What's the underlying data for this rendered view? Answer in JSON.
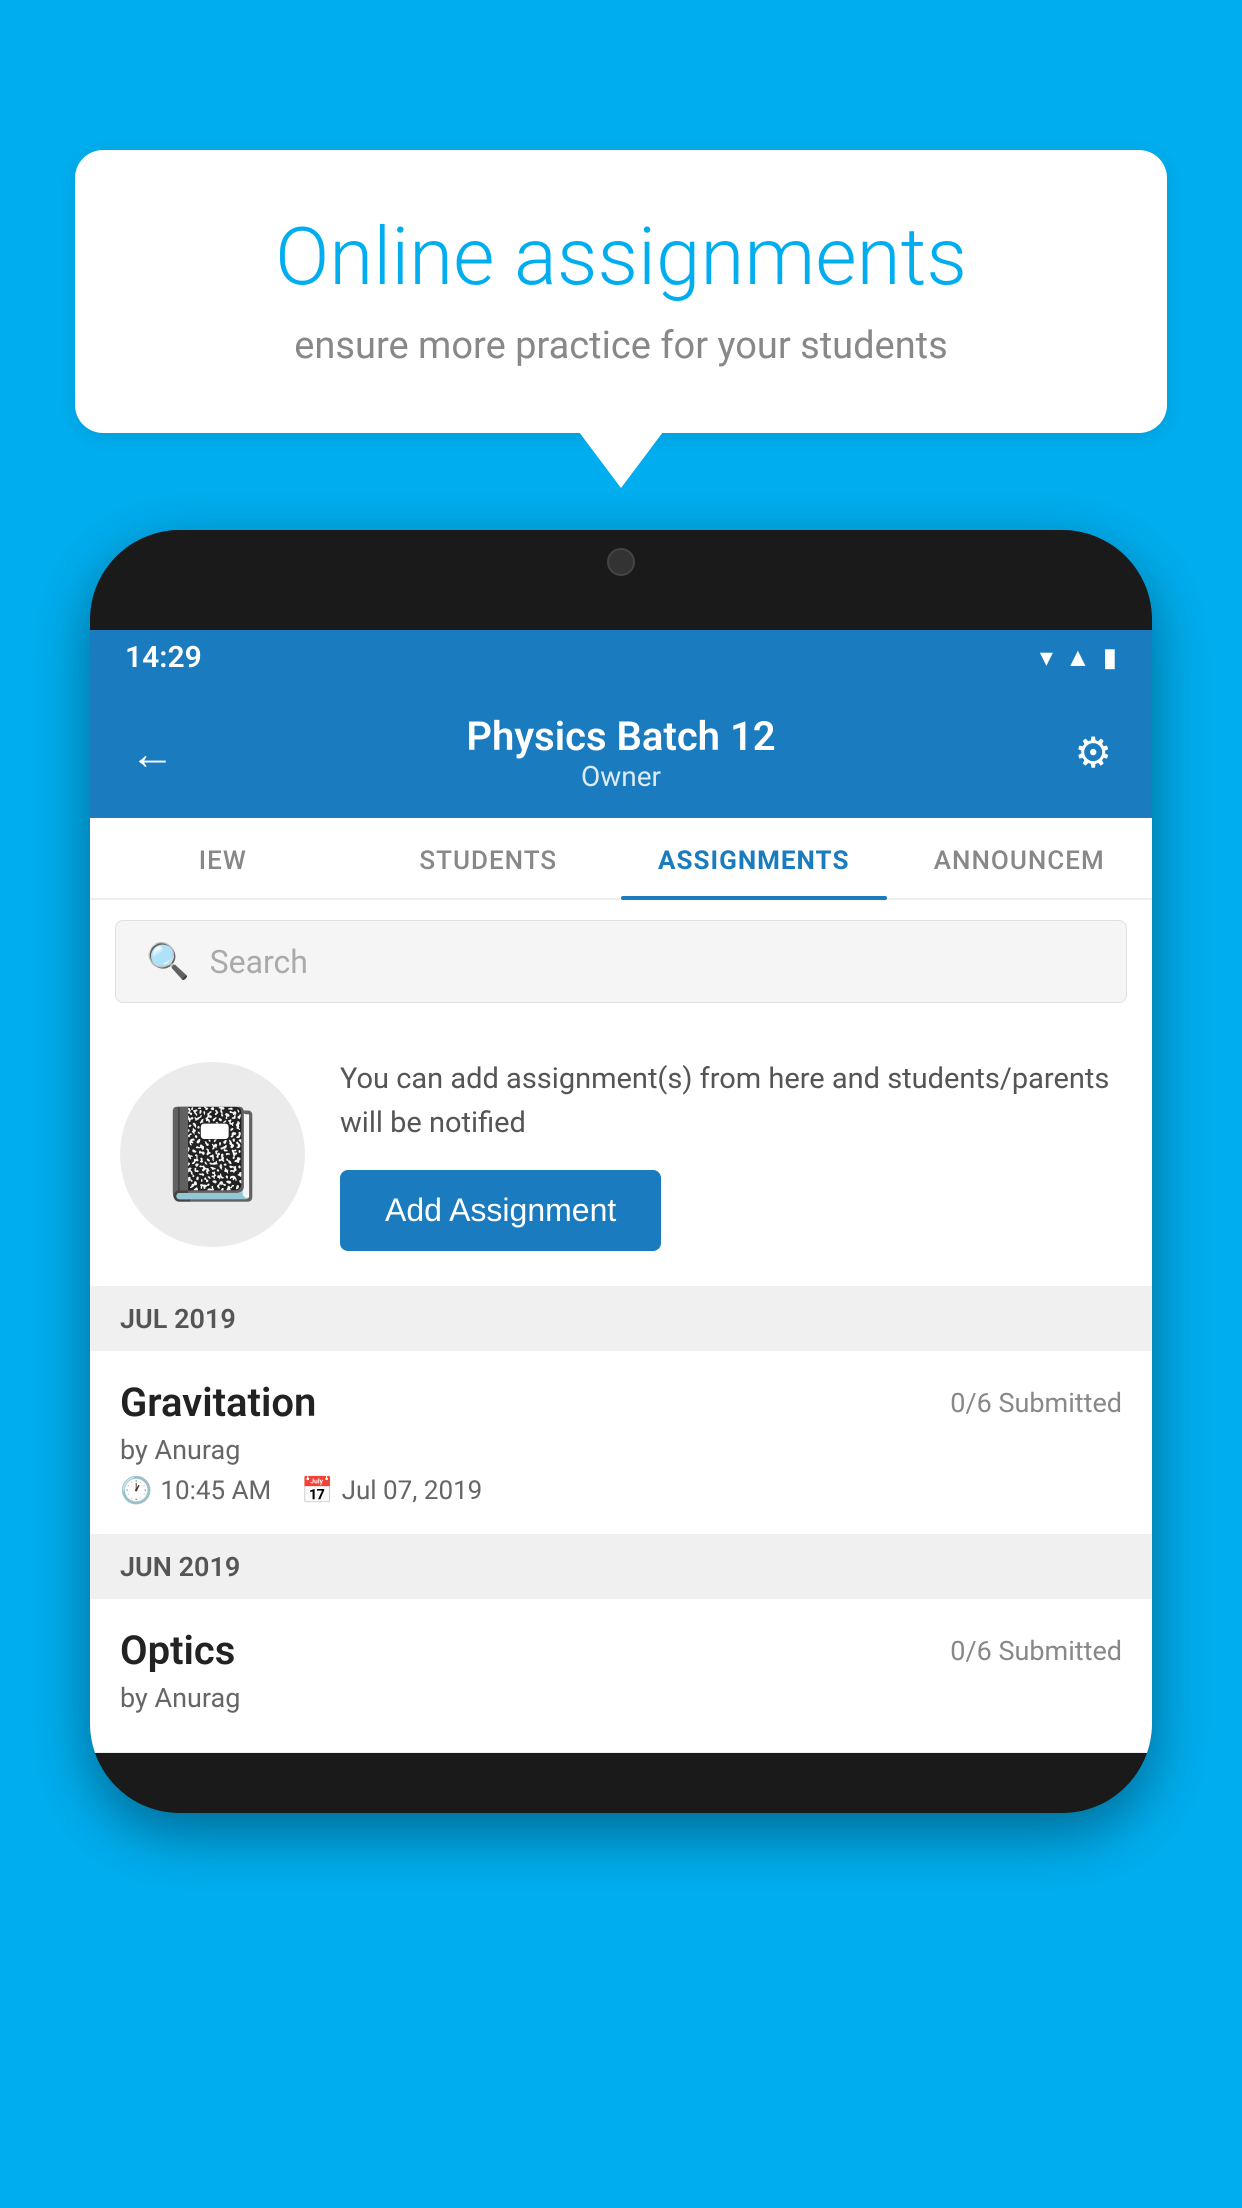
{
  "background_color": "#00AEEF",
  "speech_bubble": {
    "title": "Online assignments",
    "subtitle": "ensure more practice for your students"
  },
  "status_bar": {
    "time": "14:29",
    "icons": [
      "wifi",
      "signal",
      "battery"
    ]
  },
  "app_header": {
    "title": "Physics Batch 12",
    "subtitle": "Owner",
    "back_label": "←",
    "settings_label": "⚙"
  },
  "tabs": [
    {
      "label": "IEW",
      "active": false
    },
    {
      "label": "STUDENTS",
      "active": false
    },
    {
      "label": "ASSIGNMENTS",
      "active": true
    },
    {
      "label": "ANNOUNCEM",
      "active": false
    }
  ],
  "search": {
    "placeholder": "Search"
  },
  "add_assignment_section": {
    "description": "You can add assignment(s) from here and students/parents will be notified",
    "button_label": "Add Assignment"
  },
  "sections": [
    {
      "month_label": "JUL 2019",
      "assignments": [
        {
          "name": "Gravitation",
          "submitted": "0/6 Submitted",
          "by": "by Anurag",
          "time": "10:45 AM",
          "date": "Jul 07, 2019"
        }
      ]
    },
    {
      "month_label": "JUN 2019",
      "assignments": [
        {
          "name": "Optics",
          "submitted": "0/6 Submitted",
          "by": "by Anurag",
          "time": "",
          "date": ""
        }
      ]
    }
  ]
}
